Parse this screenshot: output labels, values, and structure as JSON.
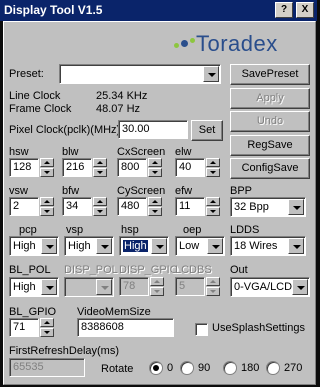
{
  "window": {
    "title": "Display Tool V1.5",
    "help": "?",
    "close": "X"
  },
  "logo": {
    "text": "Toradex"
  },
  "preset": {
    "label": "Preset:",
    "value": ""
  },
  "clocks": {
    "line_label": "Line Clock",
    "line_value": "25.34 KHz",
    "frame_label": "Frame Clock",
    "frame_value": "48.07 Hz",
    "pixel_label": "Pixel Clock(pclk)(MHz)",
    "pixel_value": "30.00",
    "set": "Set"
  },
  "buttons": {
    "save_preset": "SavePreset",
    "apply": "Apply",
    "undo": "Undo",
    "reg_save": "RegSave",
    "config_save": "ConfigSave"
  },
  "row1": {
    "hsw_label": "hsw",
    "hsw": "128",
    "blw_label": "blw",
    "blw": "216",
    "cxscreen_label": "CxScreen",
    "cxscreen": "800",
    "elw_label": "elw",
    "elw": "40"
  },
  "row2": {
    "vsw_label": "vsw",
    "vsw": "2",
    "bfw_label": "bfw",
    "bfw": "34",
    "cyscreen_label": "CyScreen",
    "cyscreen": "480",
    "efw_label": "efw",
    "efw": "11",
    "bpp_label": "BPP",
    "bpp": "32 Bpp"
  },
  "row3": {
    "pcp_label": "pcp",
    "pcp": "High",
    "vsp_label": "vsp",
    "vsp": "High",
    "hsp_label": "hsp",
    "hsp": "High",
    "oep_label": "oep",
    "oep": "Low",
    "ldds_label": "LDDS",
    "ldds": "18 Wires"
  },
  "row4": {
    "bl_pol_label": "BL_POL",
    "bl_pol": "High",
    "disp_pol_label": "DISP_POL",
    "disp_pol": "",
    "disp_gpio_label": "DISP_GPIO",
    "disp_gpio": "78",
    "lcdbs_label": "LCDBS",
    "lcdbs": "5",
    "out_label": "Out",
    "out": "0-VGA/LCD"
  },
  "row5": {
    "bl_gpio_label": "BL_GPIO",
    "bl_gpio": "71",
    "videomem_label": "VideoMemSize",
    "videomem": "8388608",
    "splash_label": "UseSplashSettings"
  },
  "row6": {
    "first_refresh_label": "FirstRefreshDelay(ms)",
    "first_refresh": "65535",
    "rotate_label": "Rotate",
    "rotate_options": [
      "0",
      "90",
      "180",
      "270"
    ],
    "rotate_selected": "0"
  }
}
